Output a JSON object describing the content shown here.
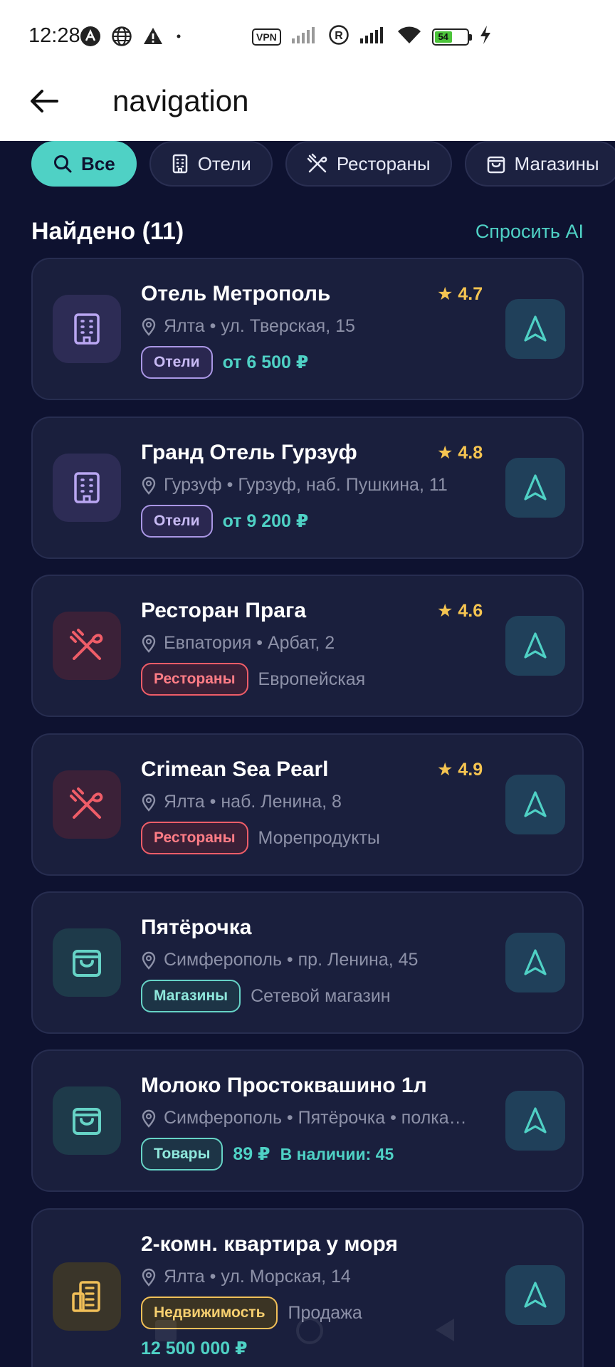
{
  "status_bar": {
    "time": "12:28",
    "vpn_label": "VPN",
    "battery_level": "54"
  },
  "app_bar": {
    "title": "navigation"
  },
  "filters": [
    {
      "label": "Все",
      "icon": "search-icon",
      "active": true
    },
    {
      "label": "Отели",
      "icon": "building-icon",
      "active": false
    },
    {
      "label": "Рестораны",
      "icon": "utensils-icon",
      "active": false
    },
    {
      "label": "Магазины",
      "icon": "bag-icon",
      "active": false
    }
  ],
  "results": {
    "title": "Найдено (11)",
    "ask_ai": "Спросить AI"
  },
  "cards": [
    {
      "title": "Отель Метрополь",
      "rating": "★ 4.7",
      "address": "Ялта • ул. Тверская, 15",
      "tag": "Отели",
      "extra": "от 6 500 ₽",
      "icon": "hotel-icon"
    },
    {
      "title": "Гранд Отель Гурзуф",
      "rating": "★ 4.8",
      "address": "Гурзуф • Гурзуф, наб. Пушкина, 11",
      "tag": "Отели",
      "extra": "от 9 200 ₽",
      "icon": "hotel-icon"
    },
    {
      "title": "Ресторан Прага",
      "rating": "★ 4.6",
      "address": "Евпатория • Арбат, 2",
      "tag": "Рестораны",
      "extra": "Европейская",
      "icon": "utensils-icon"
    },
    {
      "title": "Crimean Sea Pearl",
      "rating": "★ 4.9",
      "address": "Ялта • наб. Ленина, 8",
      "tag": "Рестораны",
      "extra": "Морепродукты",
      "icon": "utensils-icon"
    },
    {
      "title": "Пятёрочка",
      "address": "Симферополь • пр. Ленина, 45",
      "tag": "Магазины",
      "extra": "Сетевой магазин",
      "icon": "bag-icon"
    },
    {
      "title": "Молоко Простоквашино 1л",
      "address": "Симферополь • Пятёрочка • полка ...",
      "tag": "Товары",
      "extra": "89 ₽",
      "extra2": "В наличии: 45",
      "icon": "bag-icon"
    },
    {
      "title": "2-комн. квартира у моря",
      "address": "Ялта • ул. Морская, 14",
      "tag": "Недвижимость",
      "extra": "Продажа",
      "price_line": "12 500 000 ₽",
      "icon": "apartment-icon"
    }
  ],
  "colors": {
    "background": "#0e1230",
    "card": "#1a1f3d",
    "accent": "#4fd1c5",
    "rating": "#f5c451",
    "hotel": "#a996e4",
    "restaurant": "#ef5d68",
    "estate": "#f1c058"
  }
}
